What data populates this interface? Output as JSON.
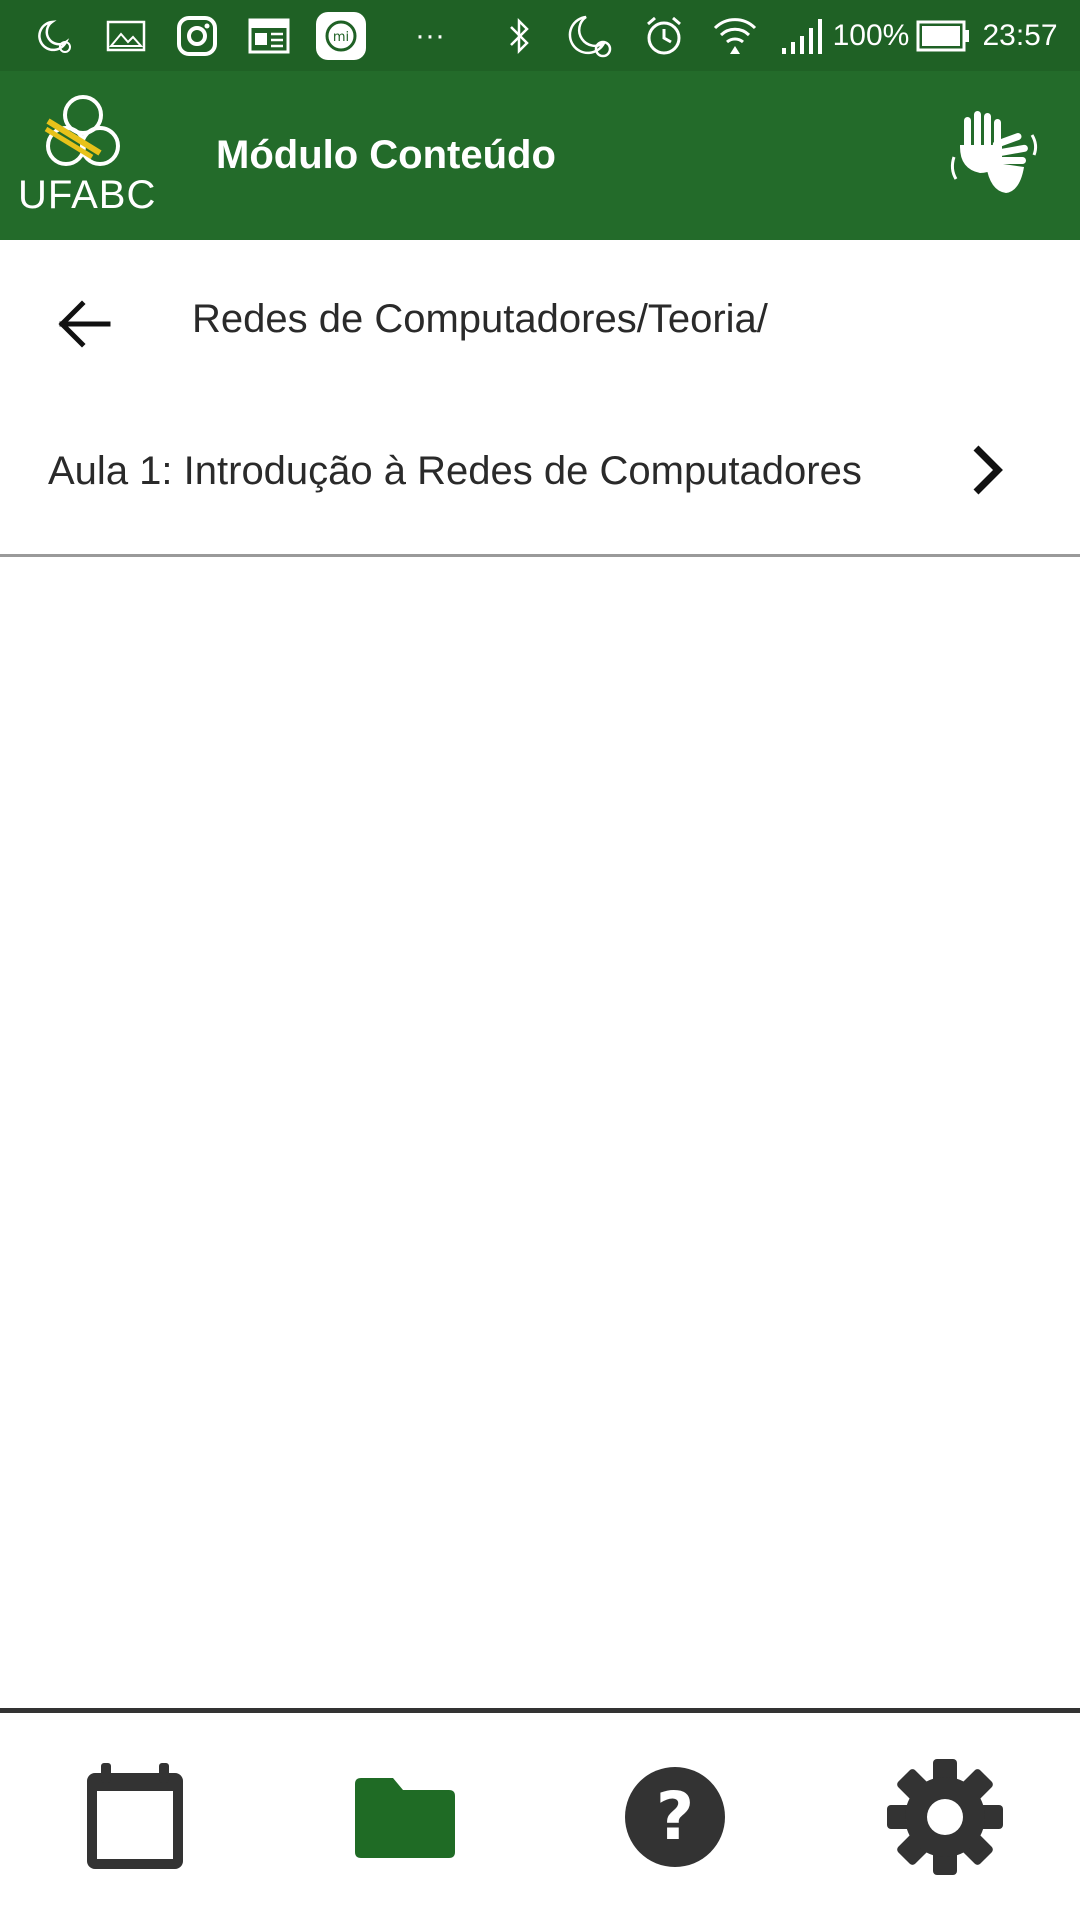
{
  "status_bar": {
    "battery": "100%",
    "time": "23:57",
    "overflow": "···",
    "icons": [
      "moon-alarm-icon",
      "gallery-icon",
      "instagram-icon",
      "news-icon",
      "mi-icon",
      "bluetooth-icon",
      "moon-alarm-icon",
      "alarm-icon",
      "wifi-icon",
      "signal-icon",
      "battery-icon"
    ]
  },
  "app_bar": {
    "logo_text": "UFABC",
    "title": "Módulo Conteúdo",
    "libras_icon": "sign-language-icon"
  },
  "breadcrumb": {
    "path": "Redes de Computadores/Teoria/",
    "back_icon": "arrow-left-icon"
  },
  "content": {
    "items": [
      {
        "label": "Aula 1: Introdução à Redes de Computadores",
        "icon": "chevron-right-icon"
      }
    ]
  },
  "bottom_nav": {
    "items": [
      {
        "icon": "calendar-icon",
        "active": false
      },
      {
        "icon": "folder-icon",
        "active": true
      },
      {
        "icon": "help-icon",
        "active": false
      },
      {
        "icon": "settings-icon",
        "active": false
      }
    ]
  },
  "colors": {
    "status_bar": "#1f6125",
    "app_bar": "#236b2a",
    "active_nav": "#1f6b25",
    "inactive_nav": "#333333",
    "logo_accent": "#e8c21a"
  }
}
